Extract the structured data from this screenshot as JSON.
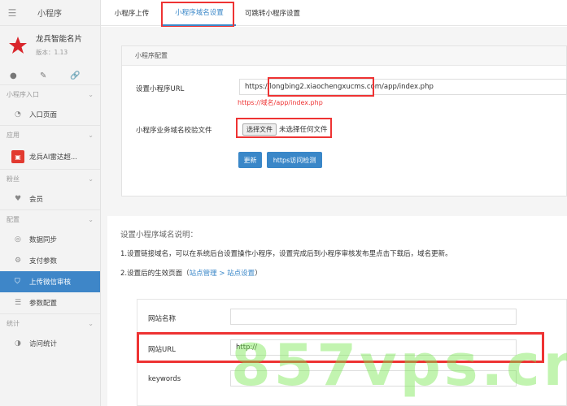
{
  "sidebar": {
    "title": "小程序",
    "brand": {
      "name": "龙兵智能名片",
      "version": "版本：1.13"
    },
    "sections": [
      {
        "label": "小程序入口",
        "items": [
          {
            "label": "入口页面",
            "icon": "gauge-icon"
          }
        ]
      },
      {
        "label": "应用",
        "items": [
          {
            "label": "龙兵AI雷达超...",
            "icon": "app-icon"
          }
        ]
      },
      {
        "label": "粉丝",
        "items": [
          {
            "label": "会员",
            "icon": "heart-icon"
          }
        ]
      },
      {
        "label": "配置",
        "items": [
          {
            "label": "数据同步",
            "icon": "sync-icon"
          },
          {
            "label": "支付参数",
            "icon": "gear-icon"
          },
          {
            "label": "上传微信审核",
            "icon": "shield-icon",
            "active": true
          },
          {
            "label": "参数配置",
            "icon": "list-icon"
          }
        ]
      },
      {
        "label": "统计",
        "items": [
          {
            "label": "访问统计",
            "icon": "chart-icon"
          }
        ]
      }
    ]
  },
  "tabs": [
    {
      "label": "小程序上传"
    },
    {
      "label": "小程序域名设置",
      "active": true
    },
    {
      "label": "可跳转小程序设置"
    }
  ],
  "config": {
    "header": "小程序配置",
    "url_label": "设置小程序URL",
    "url_value": "https://longbing2.xiaochengxucms.com/app/index.php",
    "url_hint": "https://域名/app/index.php",
    "file_label": "小程序业务域名校验文件",
    "file_button": "选择文件",
    "file_status": "未选择任何文件",
    "update_button": "更新",
    "check_button": "https访问检测"
  },
  "desc": {
    "title": "设置小程序域名说明：",
    "line1": "1.设置链接域名，可以在系统后台设置操作小程序，设置完成后到小程序审核发布里点击下载后，域名更新。",
    "line2_prefix": "2.设置后的生效页面（",
    "line2_link1": "站点管理",
    "line2_sep": " > ",
    "line2_link2": "站点设置",
    "line2_suffix": "）",
    "rows": [
      {
        "label": "网站名称",
        "value": ""
      },
      {
        "label": "网站URL",
        "value": "http://"
      },
      {
        "label": "keywords",
        "value": ""
      }
    ]
  },
  "watermark": "857vps.cn",
  "colors": {
    "accent": "#3a87c8",
    "highlight": "#e33333",
    "watermark": "#78e650"
  }
}
